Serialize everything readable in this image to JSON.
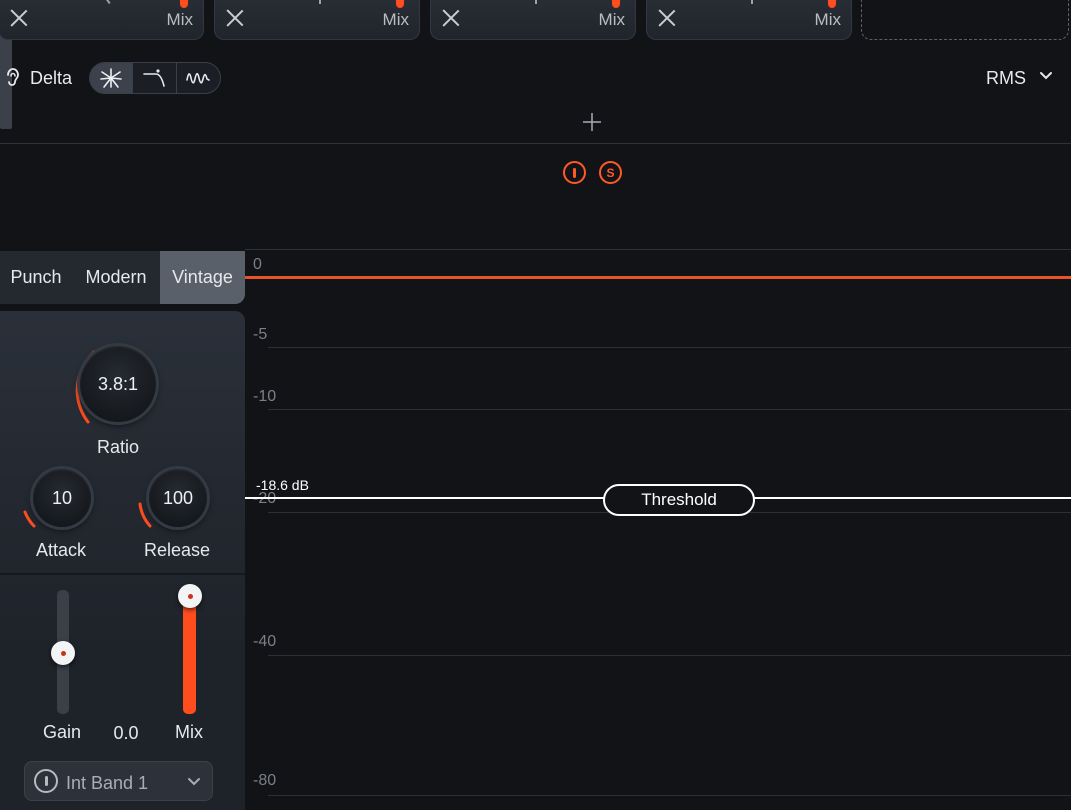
{
  "modules": [
    {
      "mix_label": "Mix"
    },
    {
      "mix_label": "Mix"
    },
    {
      "mix_label": "Mix"
    },
    {
      "mix_label": "Mix"
    }
  ],
  "toolbar": {
    "delta_label": "Delta",
    "detection": "RMS",
    "icons": [
      "ear-icon",
      "starburst-icon",
      "curve-icon",
      "wave-icon",
      "chevron-down-icon",
      "plus-icon"
    ]
  },
  "band_buttons": {
    "solo_label": "S"
  },
  "styles": {
    "tabs": [
      "Punch",
      "Modern",
      "Vintage"
    ],
    "active": "Vintage"
  },
  "knobs": {
    "ratio": {
      "value": "3.8:1",
      "label": "Ratio"
    },
    "attack": {
      "value": "10",
      "label": "Attack"
    },
    "release": {
      "value": "100",
      "label": "Release"
    }
  },
  "faders": {
    "gain": {
      "label": "Gain",
      "level": 0.5
    },
    "meter": {
      "value": "0.0"
    },
    "mix": {
      "label": "Mix",
      "level": 1.0
    }
  },
  "band_select": {
    "label": "Int Band 1"
  },
  "graph": {
    "ticks": [
      "0",
      "-5",
      "-10",
      "-20",
      "-40",
      "-80"
    ],
    "threshold_value": "-18.6 dB",
    "threshold_label": "Threshold"
  },
  "colors": {
    "accent": "#ff4d1e",
    "background": "#121317",
    "panel": "#262b33"
  }
}
